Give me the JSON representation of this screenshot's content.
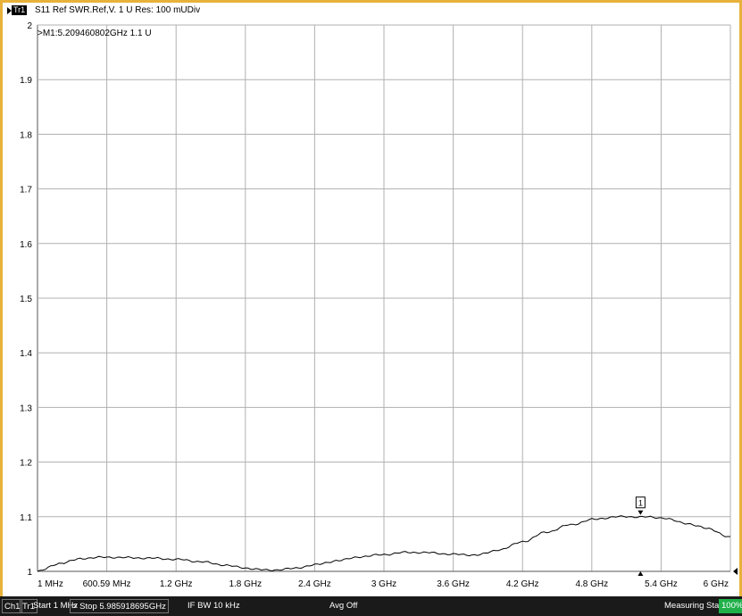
{
  "header": {
    "trace_tag": "Tr1",
    "trace_info": "S11 Ref SWR.Ref,V. 1 U Res: 100 mUDiv"
  },
  "marker": {
    "readout": ">M1:5.209460802GHz 1.1 U",
    "label": "1",
    "frequency_ghz": 5.2095,
    "value": 1.1
  },
  "status_bar": {
    "channel": "Ch1",
    "trace": "Tr1",
    "start": "Start 1 MHz",
    "stop": "> Stop 5.985918695GHz",
    "if_bw": "IF BW 10 kHz",
    "avg": "Avg Off",
    "measuring_state": "Measuring State",
    "measuring_pct": "100%"
  },
  "colors": {
    "frame": "#e7b13a",
    "trace": "#000000",
    "grid": "#b0b0b0",
    "status_bg": "#1a1a1a",
    "measuring_ok": "#1fb04a"
  },
  "chart_data": {
    "type": "line",
    "title": "S11 Ref SWR",
    "xlabel": "",
    "ylabel": "",
    "x_unit": "GHz",
    "xlim": [
      0.001,
      5.985918695
    ],
    "ylim": [
      1.0,
      2.0
    ],
    "grid": true,
    "x_tick_labels": [
      "1 MHz",
      "600.59 MHz",
      "1.2 GHz",
      "1.8 GHz",
      "2.4 GHz",
      "3 GHz",
      "3.6 GHz",
      "4.2 GHz",
      "4.8 GHz",
      "5.4 GHz",
      "6 GHz"
    ],
    "y_tick_labels": [
      "2",
      "1.9",
      "1.8",
      "1.7",
      "1.6",
      "1.5",
      "1.4",
      "1.3",
      "1.2",
      "1.1",
      "1"
    ],
    "series": [
      {
        "x": [
          0.001,
          0.2,
          0.4,
          0.6,
          0.8,
          1.0,
          1.2,
          1.4,
          1.6,
          1.8,
          2.0,
          2.2,
          2.4,
          2.6,
          2.8,
          3.0,
          3.2,
          3.4,
          3.6,
          3.8,
          4.0,
          4.2,
          4.4,
          4.6,
          4.8,
          5.0,
          5.2,
          5.4,
          5.6,
          5.8,
          5.986
        ],
        "y": [
          1.0,
          1.015,
          1.024,
          1.026,
          1.025,
          1.024,
          1.022,
          1.018,
          1.012,
          1.006,
          1.002,
          1.005,
          1.012,
          1.02,
          1.027,
          1.031,
          1.035,
          1.034,
          1.031,
          1.03,
          1.04,
          1.055,
          1.072,
          1.085,
          1.095,
          1.1,
          1.1,
          1.098,
          1.088,
          1.078,
          1.062
        ]
      }
    ]
  }
}
